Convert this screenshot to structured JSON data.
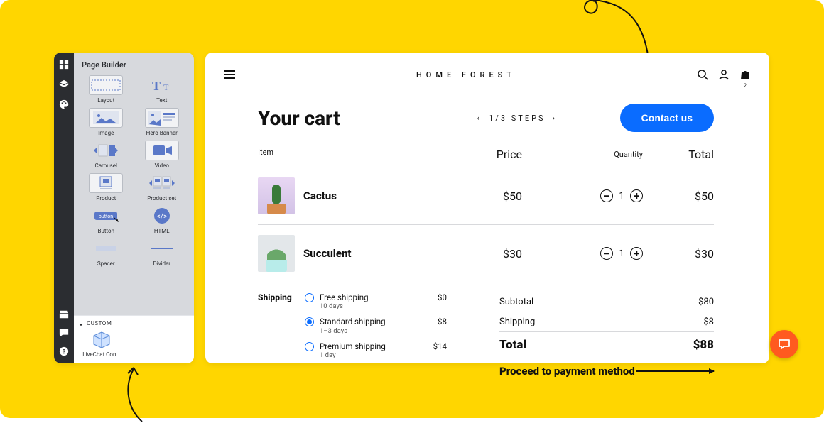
{
  "builder": {
    "title": "Page Builder",
    "rail_icons": [
      "grid-icon",
      "layers-icon",
      "palette-icon"
    ],
    "rail_bottom_icons": [
      "store-icon",
      "comment-icon",
      "help-icon"
    ],
    "blocks": [
      {
        "label": "Layout"
      },
      {
        "label": "Text"
      },
      {
        "label": "Image"
      },
      {
        "label": "Hero Banner"
      },
      {
        "label": "Carousel"
      },
      {
        "label": "Video"
      },
      {
        "label": "Product"
      },
      {
        "label": "Product set"
      },
      {
        "label": "Button"
      },
      {
        "label": "HTML"
      },
      {
        "label": "Spacer"
      },
      {
        "label": "Divider"
      }
    ],
    "custom_heading": "CUSTOM",
    "custom_block_label": "LiveChat Con..."
  },
  "store": {
    "brand": "HOME FOREST",
    "bag_count": "2",
    "cart_title": "Your cart",
    "steps": {
      "prev": "‹",
      "label": "1/3 STEPS",
      "next": "›"
    },
    "contact_button": "Contact us",
    "columns": {
      "item": "Item",
      "price": "Price",
      "quantity": "Quantity",
      "total": "Total"
    },
    "items": [
      {
        "name": "Cactus",
        "price": "$50",
        "qty": "1",
        "total": "$50",
        "thumb": "cactus"
      },
      {
        "name": "Succulent",
        "price": "$30",
        "qty": "1",
        "total": "$30",
        "thumb": "succulent"
      }
    ],
    "shipping": {
      "heading": "Shipping",
      "options": [
        {
          "label": "Free shipping",
          "sub": "10 days",
          "price": "$0",
          "selected": false
        },
        {
          "label": "Standard shipping",
          "sub": "1–3 days",
          "price": "$8",
          "selected": true
        },
        {
          "label": "Premium shipping",
          "sub": "1 day",
          "price": "$14",
          "selected": false
        }
      ]
    },
    "totals": {
      "subtotal_label": "Subtotal",
      "subtotal": "$80",
      "shipping_label": "Shipping",
      "shipping": "$8",
      "total_label": "Total",
      "total": "$88"
    },
    "proceed_label": "Proceed to payment method"
  }
}
